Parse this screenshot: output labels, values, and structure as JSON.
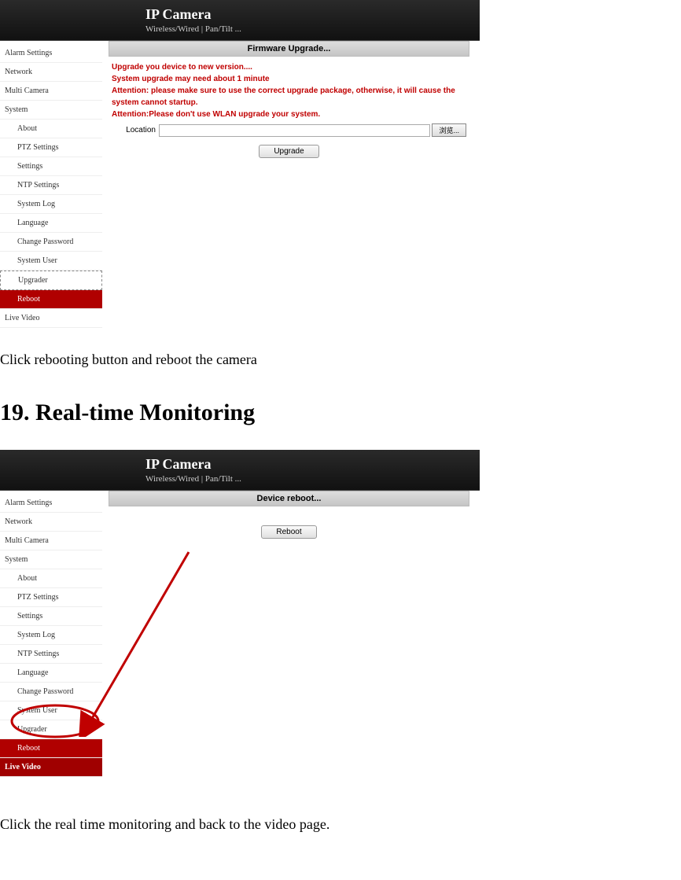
{
  "headers": {
    "title": "IP Camera",
    "subtitle": "Wireless/Wired | Pan/Tilt ..."
  },
  "sidebar1": {
    "items": [
      {
        "label": "Alarm Settings",
        "cls": ""
      },
      {
        "label": "Network",
        "cls": ""
      },
      {
        "label": "Multi Camera",
        "cls": ""
      },
      {
        "label": "System",
        "cls": ""
      },
      {
        "label": "About",
        "cls": "sub"
      },
      {
        "label": "PTZ Settings",
        "cls": "sub"
      },
      {
        "label": "Settings",
        "cls": "sub"
      },
      {
        "label": "NTP Settings",
        "cls": "sub"
      },
      {
        "label": "System Log",
        "cls": "sub"
      },
      {
        "label": "Language",
        "cls": "sub"
      },
      {
        "label": "Change Password",
        "cls": "sub"
      },
      {
        "label": "System User",
        "cls": "sub"
      },
      {
        "label": "Upgrader",
        "cls": "dashed"
      },
      {
        "label": "Reboot",
        "cls": "active-red"
      },
      {
        "label": "Live Video",
        "cls": ""
      }
    ]
  },
  "panel1": {
    "title": "Firmware Upgrade...",
    "lines": [
      "Upgrade you device to new version....",
      "System upgrade may need about 1 minute",
      "Attention: please make sure to use the correct upgrade package, otherwise, it will cause the system cannot startup.",
      "Attention:Please don't use WLAN upgrade your system."
    ],
    "location_label": "Location",
    "browse": "浏览...",
    "upgrade_btn": "Upgrade"
  },
  "doc": {
    "text1": "Click rebooting button and reboot the camera",
    "heading": "19. Real-time Monitoring",
    "text2": "Click the real time monitoring and back to the video page."
  },
  "sidebar2": {
    "items": [
      {
        "label": "Alarm Settings",
        "cls": ""
      },
      {
        "label": "Network",
        "cls": ""
      },
      {
        "label": "Multi Camera",
        "cls": ""
      },
      {
        "label": "System",
        "cls": ""
      },
      {
        "label": "About",
        "cls": "sub"
      },
      {
        "label": "PTZ Settings",
        "cls": "sub"
      },
      {
        "label": "Settings",
        "cls": "sub"
      },
      {
        "label": "System Log",
        "cls": "sub"
      },
      {
        "label": "NTP Settings",
        "cls": "sub"
      },
      {
        "label": "Language",
        "cls": "sub"
      },
      {
        "label": "Change Password",
        "cls": "sub"
      },
      {
        "label": "System User",
        "cls": "sub"
      },
      {
        "label": "Upgrader",
        "cls": "sub"
      },
      {
        "label": "Reboot",
        "cls": "active-red"
      },
      {
        "label": "Live Video",
        "cls": "active-red-main"
      }
    ]
  },
  "panel2": {
    "title": "Device reboot...",
    "reboot_btn": "Reboot"
  }
}
